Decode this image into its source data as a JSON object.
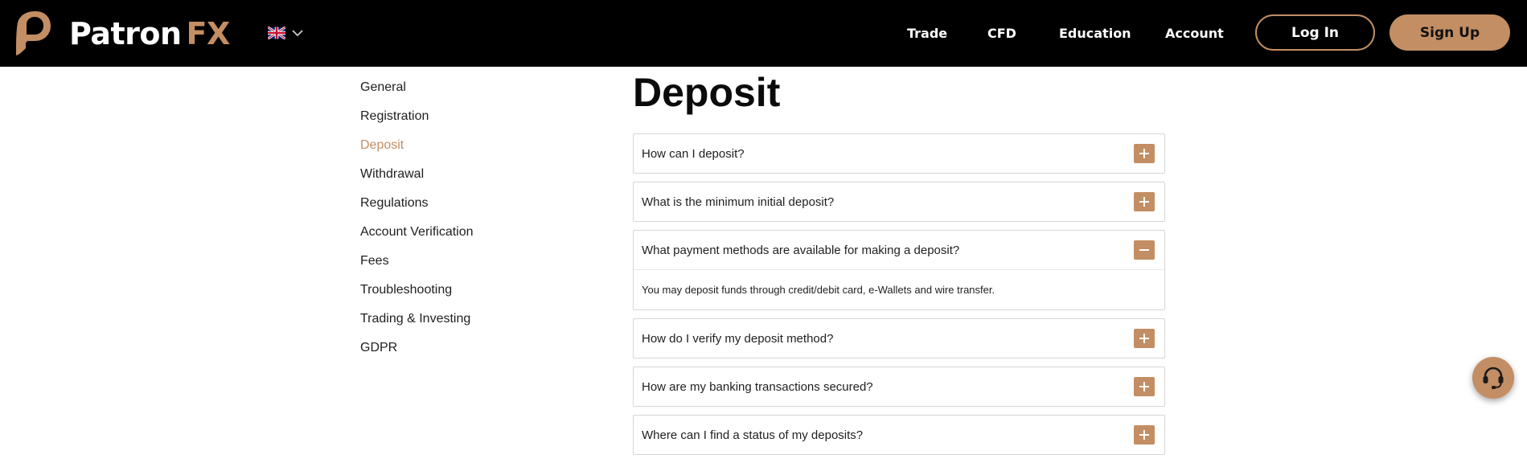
{
  "header": {
    "logo": {
      "text_white": "Patron",
      "text_accent": "FX",
      "icon": "patronfx-p-logo-icon"
    },
    "language": {
      "flag_icon": "uk-flag-icon",
      "dropdown_icon": "chevron-down-icon"
    },
    "nav": [
      {
        "label": "Trade"
      },
      {
        "label": "CFD"
      },
      {
        "label": "Education"
      },
      {
        "label": "Account"
      }
    ],
    "login_label": "Log In",
    "signup_label": "Sign Up"
  },
  "sidebar": {
    "items": [
      {
        "label": "General"
      },
      {
        "label": "Registration"
      },
      {
        "label": "Deposit",
        "active": true
      },
      {
        "label": "Withdrawal"
      },
      {
        "label": "Regulations"
      },
      {
        "label": "Account Verification"
      },
      {
        "label": "Fees"
      },
      {
        "label": "Troubleshooting"
      },
      {
        "label": "Trading & Investing"
      },
      {
        "label": "GDPR"
      }
    ]
  },
  "main": {
    "title": "Deposit",
    "faq": [
      {
        "question": "How can I deposit?",
        "expanded": false
      },
      {
        "question": "What is the minimum initial deposit?",
        "expanded": false
      },
      {
        "question": "What payment methods are available for making a deposit?",
        "expanded": true,
        "answer": "You may deposit funds through credit/debit card, e-Wallets and wire transfer."
      },
      {
        "question": "How do I verify my deposit method?",
        "expanded": false
      },
      {
        "question": "How are my banking transactions secured?",
        "expanded": false
      },
      {
        "question": "Where can I find a status of my deposits?",
        "expanded": false
      }
    ]
  },
  "support": {
    "icon": "headset-icon"
  },
  "colors": {
    "accent": "#c38e63",
    "header_bg": "#000000",
    "text": "#1f1f1f",
    "border": "#d6d6d6"
  }
}
